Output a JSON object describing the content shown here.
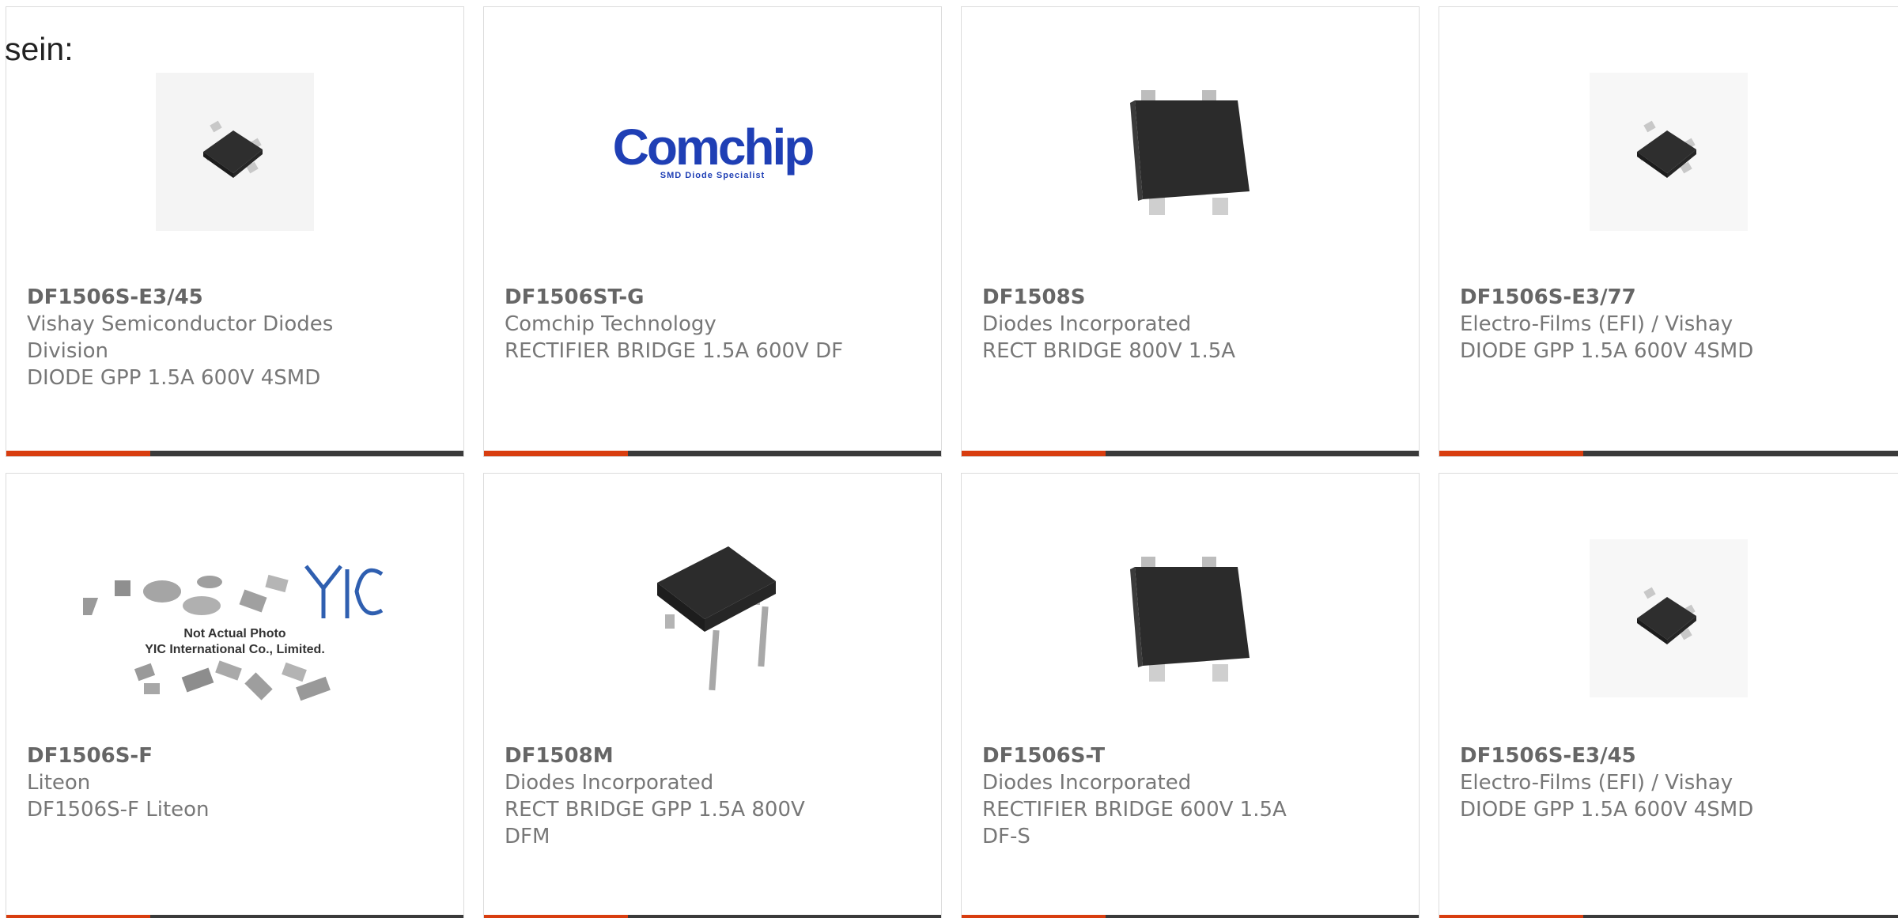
{
  "intro_text": "sein:",
  "colors": {
    "accent": "#d83d0f",
    "bar": "#3a3a3a",
    "comchip_blue": "#1f3fb5",
    "yic_blue": "#2f5fb0"
  },
  "products": [
    {
      "part": "DF1506S-E3/45",
      "manufacturer": "Vishay Semiconductor Diodes\nDivision",
      "description": "DIODE GPP 1.5A 600V 4SMD",
      "image": "smd-bridge-small-photo"
    },
    {
      "part": "DF1506ST-G",
      "manufacturer": "Comchip Technology",
      "description": "RECTIFIER BRIDGE 1.5A 600V DF",
      "image": "comchip-logo",
      "logo_text": "Comchip",
      "logo_subtext": "SMD Diode Specialist"
    },
    {
      "part": "DF1508S",
      "manufacturer": "Diodes Incorporated",
      "description": "RECT BRIDGE 800V 1.5A",
      "image": "smd-bridge-large-photo"
    },
    {
      "part": "DF1506S-E3/77",
      "manufacturer": "Electro-Films (EFI) / Vishay",
      "description": "DIODE GPP 1.5A 600V 4SMD",
      "image": "smd-bridge-small-photo"
    },
    {
      "part": "DF1506S-F",
      "manufacturer": "Liteon",
      "description": "DF1506S-F Liteon",
      "image": "yic-placeholder",
      "placeholder_line1": "Not Actual Photo",
      "placeholder_line2": "YIC International Co., Limited."
    },
    {
      "part": "DF1508M",
      "manufacturer": "Diodes Incorporated",
      "description": "RECT BRIDGE GPP 1.5A 800V\nDFM",
      "image": "dip-bridge-photo"
    },
    {
      "part": "DF1506S-T",
      "manufacturer": "Diodes Incorporated",
      "description": "RECTIFIER BRIDGE 600V 1.5A\nDF-S",
      "image": "smd-bridge-large-photo"
    },
    {
      "part": "DF1506S-E3/45",
      "manufacturer": "Electro-Films (EFI) / Vishay",
      "description": "DIODE GPP 1.5A 600V 4SMD",
      "image": "smd-bridge-small-photo"
    }
  ]
}
